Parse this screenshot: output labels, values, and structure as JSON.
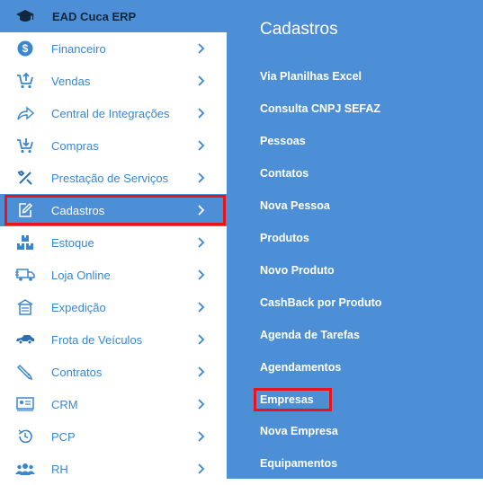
{
  "app": {
    "title": "EAD Cuca ERP",
    "logo_icon": "graduation-cap-icon"
  },
  "sidebar": {
    "items": [
      {
        "label": "Financeiro",
        "icon": "dollar-icon"
      },
      {
        "label": "Vendas",
        "icon": "cart-up-icon"
      },
      {
        "label": "Central de Integrações",
        "icon": "share-arrow-icon"
      },
      {
        "label": "Compras",
        "icon": "cart-down-icon"
      },
      {
        "label": "Prestação de Serviços",
        "icon": "tools-icon"
      },
      {
        "label": "Cadastros",
        "icon": "edit-icon",
        "active": true
      },
      {
        "label": "Estoque",
        "icon": "boxes-icon"
      },
      {
        "label": "Loja Online",
        "icon": "truck-icon"
      },
      {
        "label": "Expedição",
        "icon": "building-icon"
      },
      {
        "label": "Frota de Veículos",
        "icon": "car-icon"
      },
      {
        "label": "Contratos",
        "icon": "pen-icon"
      },
      {
        "label": "CRM",
        "icon": "id-card-icon"
      },
      {
        "label": "PCP",
        "icon": "clock-icon"
      },
      {
        "label": "RH",
        "icon": "users-icon"
      }
    ]
  },
  "submenu": {
    "title": "Cadastros",
    "items": [
      "Via Planilhas Excel",
      "Consulta CNPJ SEFAZ",
      "Pessoas",
      "Contatos",
      "Nova Pessoa",
      "Produtos",
      "Novo Produto",
      "CashBack por Produto",
      "Agenda de Tarefas",
      "Agendamentos",
      "Empresas",
      "Nova Empresa",
      "Equipamentos"
    ],
    "highlighted": "Empresas"
  },
  "colors": {
    "accent": "#4d8fd6",
    "text_blue": "#3a86cf",
    "highlight_red": "#e8141a"
  }
}
